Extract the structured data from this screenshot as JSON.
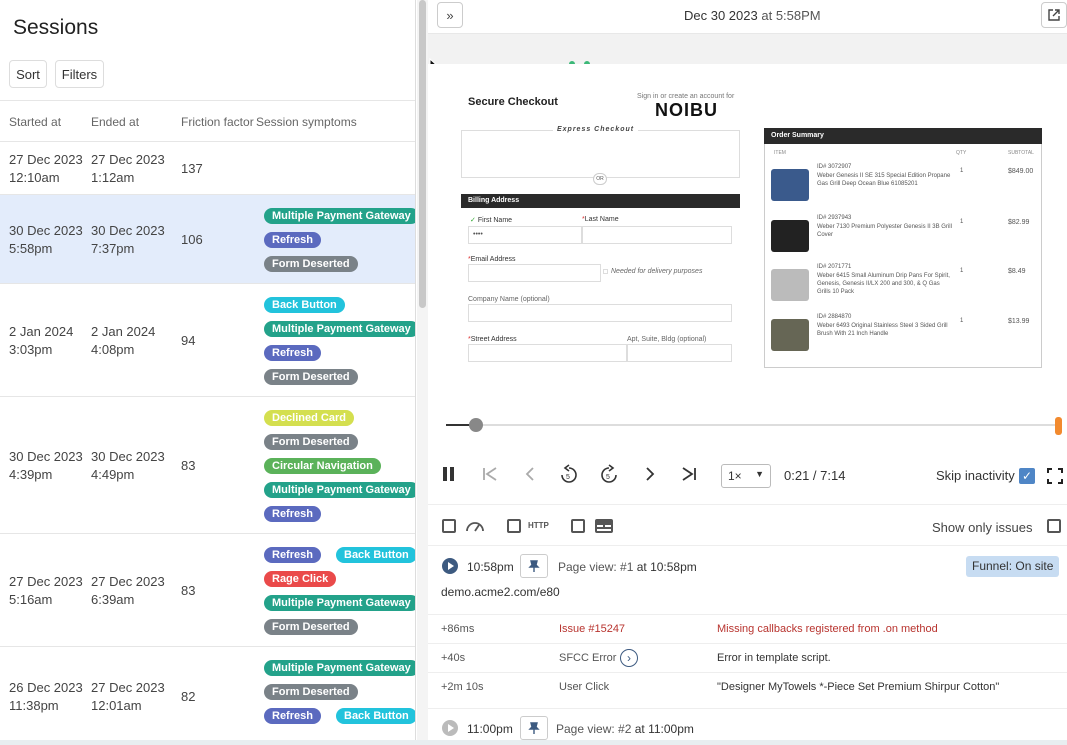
{
  "sessions": {
    "title": "Sessions",
    "sort_label": "Sort",
    "filters_label": "Filters",
    "columns": {
      "started": "Started at",
      "ended": "Ended at",
      "friction": "Friction factor",
      "symptoms": "Session symptoms"
    },
    "rows": [
      {
        "start_date": "27 Dec 2023",
        "start_time": "12:10am",
        "end_date": "27 Dec 2023",
        "end_time": "1:12am",
        "friction": "137",
        "tags": []
      },
      {
        "start_date": "30 Dec 2023",
        "start_time": "5:58pm",
        "end_date": "30 Dec 2023",
        "end_time": "7:37pm",
        "friction": "106",
        "tags": [
          "Multiple Payment Gateway",
          "Refresh",
          "Form Deserted"
        ]
      },
      {
        "start_date": "2 Jan 2024",
        "start_time": "3:03pm",
        "end_date": "2 Jan 2024",
        "end_time": "4:08pm",
        "friction": "94",
        "tags": [
          "Back Button",
          "Multiple Payment Gateway",
          "Refresh",
          "Form Deserted"
        ]
      },
      {
        "start_date": "30 Dec 2023",
        "start_time": "4:39pm",
        "end_date": "30 Dec 2023",
        "end_time": "4:49pm",
        "friction": "83",
        "tags": [
          "Declined Card",
          "Form Deserted",
          "Circular Navigation",
          "Multiple Payment Gateway",
          "Refresh"
        ]
      },
      {
        "start_date": "27 Dec 2023",
        "start_time": "5:16am",
        "end_date": "27 Dec 2023",
        "end_time": "6:39am",
        "friction": "83",
        "tags": [
          "Refresh",
          "Back Button",
          "Rage Click",
          "Multiple Payment Gateway",
          "Form Deserted"
        ]
      },
      {
        "start_date": "26 Dec 2023",
        "start_time": "11:38pm",
        "end_date": "27 Dec 2023",
        "end_time": "12:01am",
        "friction": "82",
        "tags": [
          "Multiple Payment Gateway",
          "Form Deserted",
          "Refresh",
          "Back Button"
        ]
      }
    ]
  },
  "tag_colors": {
    "Multiple Payment Gateway": "#23a28a",
    "Refresh": "#5b6abf",
    "Form Deserted": "#7a8288",
    "Back Button": "#22c3dc",
    "Declined Card": "#d4df4f",
    "Circular Navigation": "#5bb25a",
    "Rage Click": "#ea4a4a"
  },
  "player": {
    "date": "Dec 30 2023",
    "at_time": "at 5:58PM",
    "progress": 0.049,
    "speed": "1×",
    "time": "0:21 / 7:14",
    "skip_label": "Skip inactivity",
    "skip_checked": true
  },
  "checkout": {
    "title": "Secure Checkout",
    "signin": "Sign in or create an account for",
    "logo": "NOIBU",
    "express": "Express Checkout",
    "or": "OR",
    "billing": "Billing Address",
    "first_name": "First Name",
    "last_name": "Last Name",
    "first_value": "••••",
    "email": "Email Address",
    "email_note": "Needed for delivery purposes",
    "company": "Company Name (optional)",
    "street": "Street Address",
    "apt": "Apt, Suite, Bldg (optional)",
    "summary_title": "Order Summary",
    "col_item": "ITEM",
    "col_qty": "QTY",
    "col_subtotal": "SUBTOTAL",
    "items": [
      {
        "id": "ID# 3072907",
        "desc": "Weber Genesis II SE 315 Special Edition Propane Gas Grill   Deep Ocean Blue 61085201",
        "qty": "1",
        "price": "$849.00"
      },
      {
        "id": "ID# 2937943",
        "desc": "Weber 7130 Premium Polyester Genesis II 3B Grill Cover",
        "qty": "1",
        "price": "$82.99"
      },
      {
        "id": "ID# 2071771",
        "desc": "Weber 6415 Small Aluminum Drip Pans For Spirit, Genesis, Genesis II/LX 200 and 300, & Q Gas Grills   10 Pack",
        "qty": "1",
        "price": "$8.49"
      },
      {
        "id": "ID# 2884870",
        "desc": "Weber 6493 Original Stainless Steel 3 Sided Grill Brush With 21 Inch Handle",
        "qty": "1",
        "price": "$13.99"
      }
    ]
  },
  "filters": {
    "http_label": "HTTP",
    "show_only_issues": "Show only issues"
  },
  "events": {
    "pv1_time": "10:58pm",
    "pv1_label": "Page view: #1",
    "pv1_at": "at 10:58pm",
    "funnel": "Funnel: On site",
    "url": "demo.acme2.com/e80",
    "rows": [
      {
        "offset": "+86ms",
        "type": "Issue #15247",
        "detail": "Missing callbacks registered from .on method",
        "issue": true
      },
      {
        "offset": "+40s",
        "type": "SFCC Error",
        "detail": "Error in template script.",
        "issue": false
      },
      {
        "offset": "+2m 10s",
        "type": "User Click",
        "detail": "\"Designer MyTowels *-Piece Set Premium Shirpur Cotton\"",
        "issue": false
      }
    ],
    "pv2_time": "11:00pm",
    "pv2_label": "Page view: #2",
    "pv2_at": "at 11:00pm"
  }
}
